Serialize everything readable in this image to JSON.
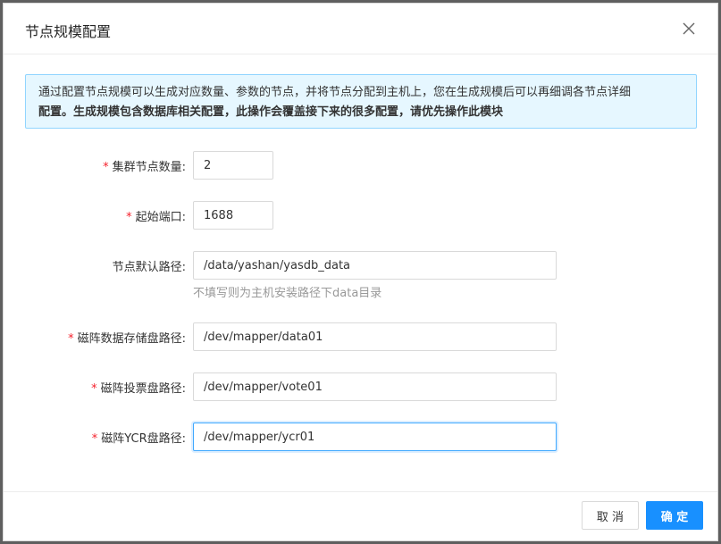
{
  "dialog": {
    "title": "节点规模配置",
    "alert": {
      "line1": "通过配置节点规模可以生成对应数量、参数的节点，并将节点分配到主机上，您在生成规模后可以再细调各节点详细",
      "line2": "配置。生成规模包含数据库相关配置，此操作会覆盖接下来的很多配置，请优先操作此模块"
    },
    "fields": [
      {
        "label": "集群节点数量:",
        "value": "2",
        "required": true
      },
      {
        "label": "起始端口:",
        "value": "1688",
        "required": true
      },
      {
        "label": "节点默认路径:",
        "value": "/data/yashan/yasdb_data",
        "required": false,
        "hint": "不填写则为主机安装路径下data目录"
      },
      {
        "label": "磁阵数据存储盘路径:",
        "value": "/dev/mapper/data01",
        "required": true
      },
      {
        "label": "磁阵投票盘路径:",
        "value": "/dev/mapper/vote01",
        "required": true
      },
      {
        "label": "磁阵YCR盘路径:",
        "value": "/dev/mapper/ycr01",
        "required": true
      }
    ],
    "required_mark": "*",
    "buttons": {
      "cancel": "取 消",
      "ok": "确 定"
    }
  }
}
